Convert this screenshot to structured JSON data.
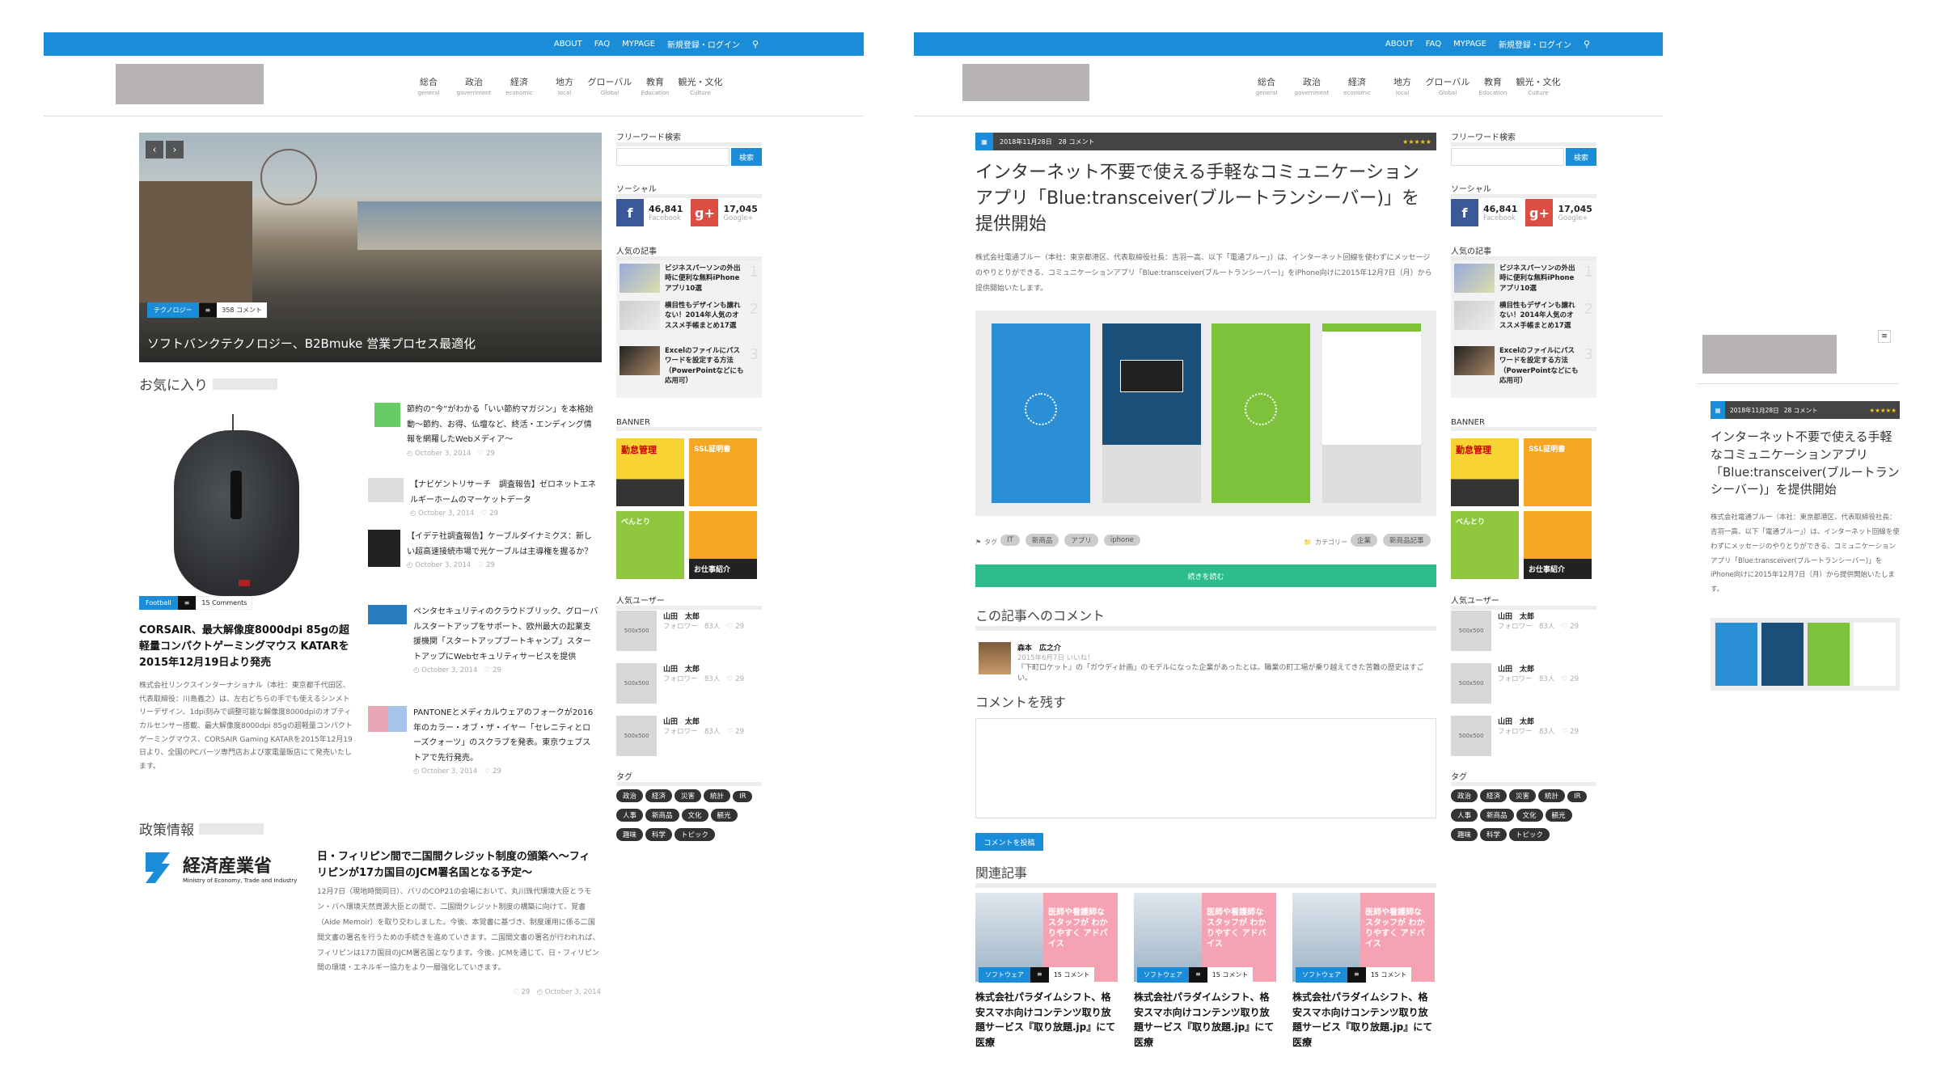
{
  "nav": {
    "about": "ABOUT",
    "faq": "FAQ",
    "mypage": "MYPAGE",
    "register": "新規登録・ログイン"
  },
  "cats": [
    {
      "jp": "総合",
      "en": "general"
    },
    {
      "jp": "政治",
      "en": "government"
    },
    {
      "jp": "経済",
      "en": "economic"
    },
    {
      "jp": "地方",
      "en": "local"
    },
    {
      "jp": "グローバル",
      "en": "Global"
    },
    {
      "jp": "教育",
      "en": "Education"
    },
    {
      "jp": "観光・文化",
      "en": "Culture"
    }
  ],
  "hero": {
    "cat": "テクノロジー",
    "comments": "358 コメント",
    "title": "ソフトバンクテクノロジー、B2Bmuke 営業プロセス最適化"
  },
  "favorites": {
    "title": "お気に入り",
    "main_cat": "Football",
    "main_comments": "15 Comments",
    "main_title": "CORSAIR、最大解像度8000dpi 85gの超軽量コンパクトゲーミングマウス KATARを2015年12月19日より発売",
    "main_text": "株式会社リンクスインターナショナル（本社：東京都千代田区、代表取締役：川島義之）は、左右どちらの手でも使えるシンメトリーデザイン、1dpi刻みで調整可能な解像度8000dpiのオプティカルセンサー搭載、最大解像度8000dpi 85gの超軽量コンパクトゲーミングマウス、CORSAIR Gaming KATARを2015年12月19日より、全国のPCパーツ専門店および家電量販店にて発売いたします。",
    "list": [
      {
        "title": "節約の“今”がわかる「いい節約マガジン」を本格始動〜節約、お得、仏壇など、終活・エンディング情報を網羅したWebメディア〜",
        "date": "October 3, 2014",
        "likes": "29"
      },
      {
        "title": "【ナビゲントリサーチ　調査報告】ゼロネットエネルギーホームのマーケットデータ",
        "date": "October 3, 2014",
        "likes": "29"
      },
      {
        "title": "【イデテ社調査報告】ケーブルダイナミクス：新しい超高速接続市場で光ケーブルは主導権を握るか？",
        "date": "October 3, 2014",
        "likes": "29"
      },
      {
        "title": "ペンタセキュリティのクラウドブリック、グローバルスタートアップをサポート、欧州最大の起業支援機関「スタートアップブートキャンプ」スタートアップにWebセキュリティサービスを提供",
        "date": "October 3, 2014",
        "likes": "29"
      },
      {
        "title": "PANTONEとメディカルウェアのフォークが2016年のカラー・オブ・ザ・イヤー「セレニティとローズクォーツ」のスクラブを発表。東京ウェブストアで先行発売。",
        "date": "October 3, 2014",
        "likes": "29"
      }
    ]
  },
  "policy": {
    "title": "政策情報",
    "logo_jp": "経済産業省",
    "logo_en": "Ministry of Economy, Trade and Industry",
    "headline": "日・フィリピン間で二国間クレジット制度の頒築へ〜フィリピンが17カ国目のJCM署名国となる予定〜",
    "text": "12月7日（現地時間同日）、パリのCOP21の会場において、丸川珠代環境大臣とラモン・パヘ環境天然資源大臣との間で、二国間クレジット制度の構築に向けて、覚書（Aide Memoir）を取り交わしました。今後、本覚書に基づき、制度運用に係る二国間文書の署名を行うための手続きを進めていきます。二国間文書の署名が行われれば、フィリピンは17カ国目のJCM署名国となります。今後、JCMを通じて、日・フィリピン間の環境・エネルギー協力をより一層強化していきます。",
    "likes": "29",
    "date": "October 3, 2014"
  },
  "sidebar": {
    "search_title": "フリーワード検索",
    "search_btn": "検索",
    "social_title": "ソーシャル",
    "fb_count": "46,841",
    "fb_label": "Facebook",
    "gp_count": "17,045",
    "gp_label": "Google+",
    "popular_title": "人気の記事",
    "popular": [
      {
        "title": "ビジネスパーソンの外出時に便利な無料iPhoneアプリ10選",
        "rank": "1"
      },
      {
        "title": "横目性もデザインも譲れない！2014年人気のオススメ手帳まとめ17選",
        "rank": "2"
      },
      {
        "title": "Excelのファイルにパスワードを設定する方法（PowerPointなどにも応用可）",
        "rank": "3"
      }
    ],
    "banner_title": "BANNER",
    "banners": [
      "勤怠管理",
      "SSL証明書",
      "べんとり",
      "お仕事紹介"
    ],
    "users_title": "人気ユーザー",
    "users": [
      {
        "name": "山田　太郎",
        "follow": "フォロワー　83人",
        "likes": "29",
        "thumb": "500x500"
      },
      {
        "name": "山田　太郎",
        "follow": "フォロワー　83人",
        "likes": "29",
        "thumb": "500x500"
      },
      {
        "name": "山田　太郎",
        "follow": "フォロワー　83人",
        "likes": "29",
        "thumb": "500x500"
      }
    ],
    "tags_title": "タグ",
    "tags": [
      "政治",
      "経済",
      "災害",
      "統計",
      "IR",
      "人事",
      "新商品",
      "文化",
      "観光",
      "趣味",
      "科学",
      "トピック"
    ]
  },
  "article": {
    "date": "2018年11月28日",
    "comments": "28 コメント",
    "stars": "★★★★★",
    "title": "インターネット不要で使える手軽なコミュニケーションアプリ「Blue:transceiver(ブルートランシーバー)」を提供開始",
    "body": "株式会社電通ブルー（本社：東京都港区、代表取締役社長：吉羽一高、以下「電通ブルー」）は、インターネット回線を使わずにメッセージのやりとりができる、コミュニケーションアプリ「Blue:transceiver(ブルートランシーバー)」をiPhone向けに2015年12月7日（月）から提供開始いたします。",
    "tag_label": "タグ",
    "tags": [
      "IT",
      "新商品",
      "アプリ",
      "iphone"
    ],
    "cat_label": "カテゴリー",
    "cats": [
      "企業",
      "新商品記事"
    ],
    "read_more": "続きを読む",
    "comment_section": "この記事へのコメント",
    "commenter": "森本　広之介",
    "comment_date": "2015年6月7日",
    "comment_like": "いいね！",
    "comment_text": "『下町ロケット』の「ガウディ計画」のモデルになった企業があったとは。職業の町工場が乗り越えてきた苦難の歴史はすごい。",
    "leave_comment": "コメントを残す",
    "post_btn": "コメントを投稿",
    "related_title": "関連記事",
    "related": [
      {
        "cat": "ソフトウェア",
        "comments": "15 コメント",
        "ad": "医師や看護師な スタッフが わかりやすく アドバイス",
        "title": "株式会社パラダイムシフト、格安スマホ向けコンテンツ取り放題サービス『取り放題.jp』にて医療"
      },
      {
        "cat": "ソフトウェア",
        "comments": "15 コメント",
        "ad": "医師や看護師な スタッフが わかりやすく アドバイス",
        "title": "株式会社パラダイムシフト、格安スマホ向けコンテンツ取り放題サービス『取り放題.jp』にて医療"
      },
      {
        "cat": "ソフトウェア",
        "comments": "15 コメント",
        "ad": "医師や看護師な スタッフが わかりやすく アドバイス",
        "title": "株式会社パラダイムシフト、格安スマホ向けコンテンツ取り放題サービス『取り放題.jp』にて医療"
      }
    ]
  },
  "mobile": {
    "date": "2018年11月28日",
    "comments": "28 コメント",
    "stars": "★★★★★",
    "title": "インターネット不要で使える手軽なコミュニケーションアプリ「Blue:transceiver(ブルートランシーバー)」を提供開始",
    "body": "株式会社電通ブルー（本社：東京都港区、代表取締役社長：吉羽一高、以下「電通ブルー」）は、インターネット回線を使わずにメッセージのやりとりができる、コミュニケーションアプリ「Blue:transceiver(ブルートランシーバー)」をiPhone向けに2015年12月7日（月）から提供開始いたします。"
  },
  "colors": {
    "accent": "#1b8dd8",
    "green": "#2dbd8a",
    "pink": "#f5a3b3"
  }
}
